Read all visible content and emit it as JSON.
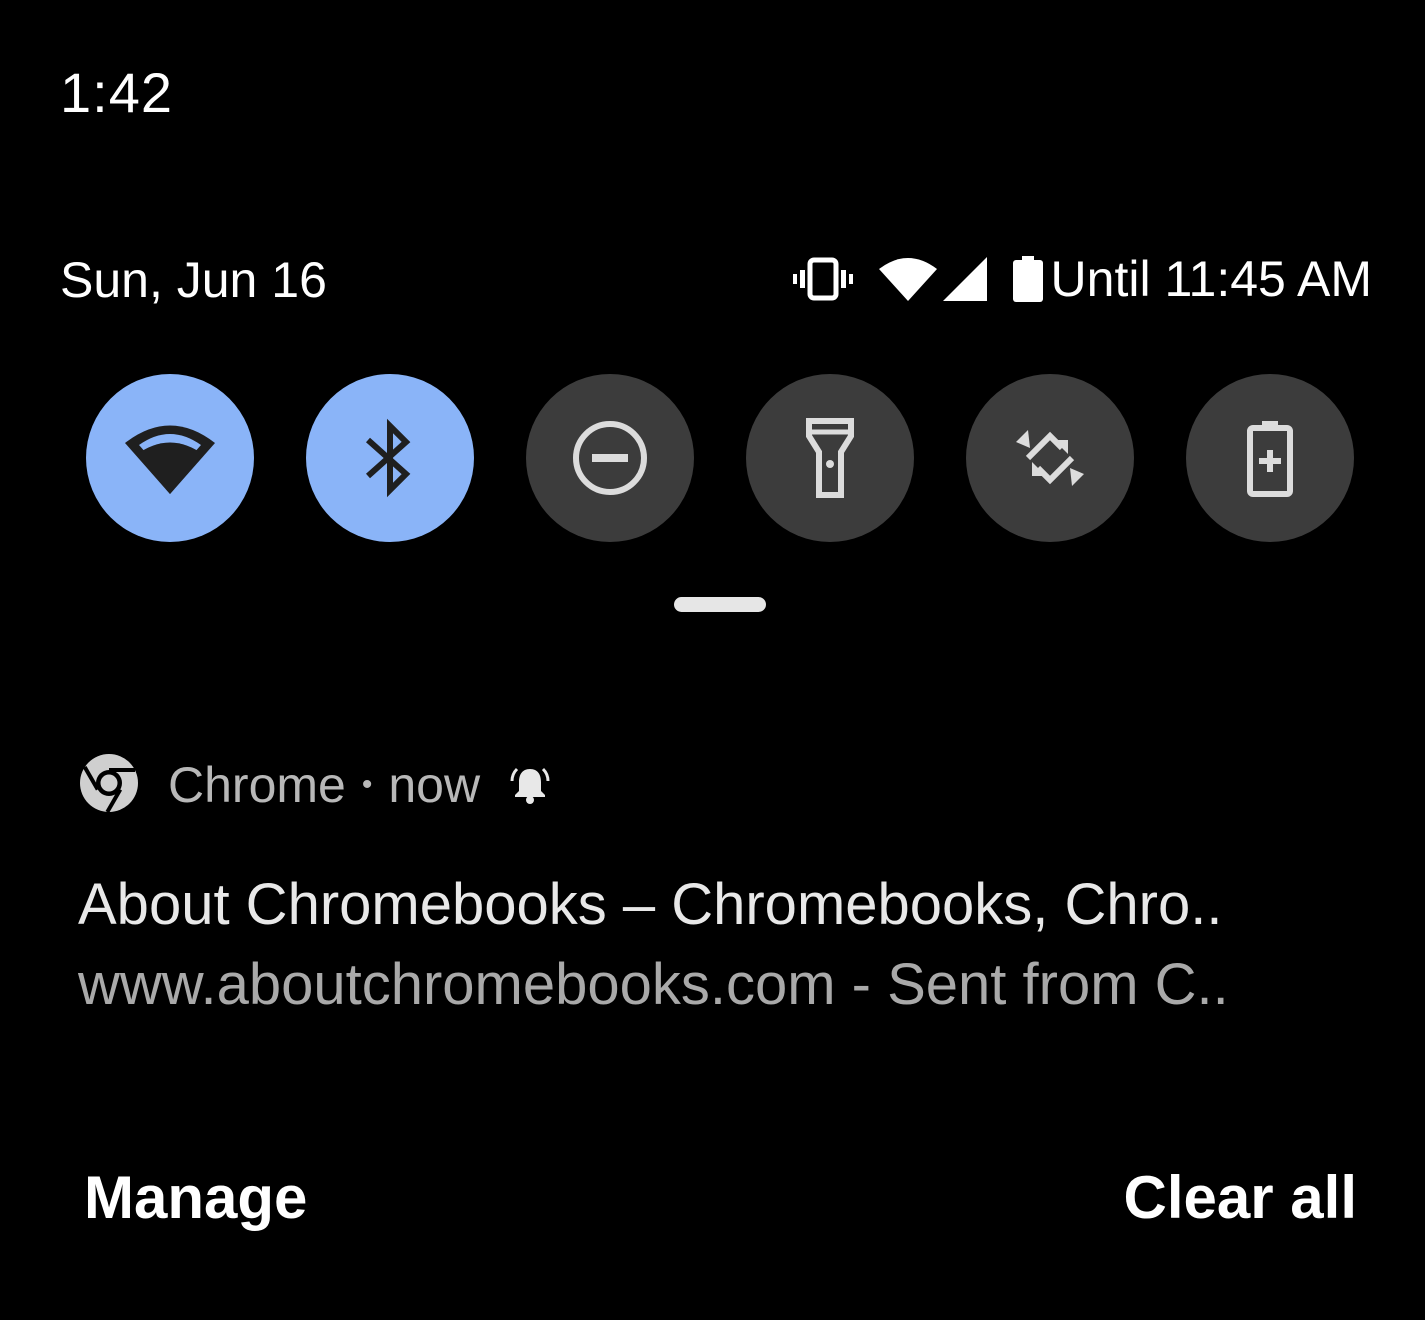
{
  "status_bar": {
    "time": "1:42"
  },
  "header": {
    "date": "Sun, Jun 16",
    "battery_text": "Until 11:45 AM",
    "icons": [
      "vibrate-icon",
      "wifi-signal-icon",
      "cell-signal-icon",
      "battery-icon"
    ]
  },
  "quick_settings": {
    "active_color": "#8ab4f8",
    "inactive_color": "#3c3c3c",
    "tiles": [
      {
        "name": "wifi",
        "icon": "wifi-icon",
        "active": true
      },
      {
        "name": "bluetooth",
        "icon": "bluetooth-icon",
        "active": true
      },
      {
        "name": "do-not-disturb",
        "icon": "do-not-disturb-icon",
        "active": false
      },
      {
        "name": "flashlight",
        "icon": "flashlight-icon",
        "active": false
      },
      {
        "name": "auto-rotate",
        "icon": "auto-rotate-icon",
        "active": false
      },
      {
        "name": "battery-saver",
        "icon": "battery-saver-icon",
        "active": false
      }
    ]
  },
  "notification": {
    "app_icon": "chrome-icon",
    "app_name": "Chrome",
    "separator": "•",
    "time": "now",
    "alert_icon": "bell-icon",
    "title": "About Chromebooks – Chromebooks, Chro..",
    "text": "www.aboutchromebooks.com - Sent from C.."
  },
  "footer": {
    "manage_label": "Manage",
    "clear_all_label": "Clear all"
  }
}
